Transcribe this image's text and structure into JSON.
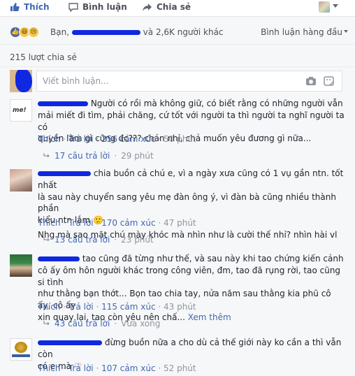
{
  "actions": {
    "like": "Thích",
    "comment": "Bình luận",
    "share": "Chia sẻ"
  },
  "reactions": {
    "icons": [
      "like-icon",
      "haha-icon",
      "sad-icon"
    ],
    "summary_prefix": "Bạn,",
    "summary_suffix": "và 2,6K người khác",
    "sort_label": "Bình luận hàng đầu"
  },
  "shares": "215 lượt chia sẻ",
  "composer": {
    "placeholder": "Viết bình luận..."
  },
  "comments": [
    {
      "text_lines": [
        "Người có rồi mà không giữ, có biết rằng có những người vẫn",
        "mải miết đi tìm, phải chăng, cứ tốt với người ta thì người ta nghĩ người ta có",
        "quyền làm gì cũng đc??? chán nhỉ, chả muốn yêu đương gì nữa..."
      ],
      "like": "Thích",
      "reply": "Trả lời",
      "reactions": "256 cảm xúc",
      "time": "50 phút",
      "replies": "17 câu trả lời",
      "replies_time": "29 phút"
    },
    {
      "text_lines": [
        "chia buồn cả chú e, vì a ngày xưa cũng có 1 vụ gần ntn. tốt nhất",
        "là sau này chuyển sang yêu mẹ đàn ông ý, vì đàn bà cũng nhiều thành phần",
        "kiểu ntn lắm"
      ],
      "extra_line": "Nhg mà sao mặt chú mày khóc mà nhìn như là cười thế nhỉ? nhìn hài vl",
      "like": "Thích",
      "reply": "Trả lời",
      "reactions": "170 cảm xúc",
      "time": "47 phút",
      "replies": "13 câu trả lời",
      "replies_time": "23 phút"
    },
    {
      "text_lines": [
        "tao cũng đã từng như thế, và sau này khi tao chứng kiến cảnh",
        "cô ấy ôm hôn người khác trong công viên, đm, tao đã rụng rời, tao cũng si tình",
        "như thằng bạn thớt... Bọn tao chia tay, nửa năm sau thằng kia phũ cô ấy, cô ấy",
        "xin quay lại, tao còn yêu nên chấ..."
      ],
      "see_more": "Xem thêm",
      "like": "Thích",
      "reply": "Trả lời",
      "reactions": "115 cảm xúc",
      "time": "43 phút",
      "replies": "43 câu trả lời",
      "replies_time": "Vừa xong"
    },
    {
      "text_lines": [
        "đừng buồn nữa a cho dù cả thế giới này ko cần a thì vẫn còn",
        "có e mà"
      ],
      "like": "Thích",
      "reply": "Trả lời",
      "reactions": "107 cảm xúc",
      "time": "52 phút"
    }
  ],
  "colors": {
    "link": "#4267b2",
    "redaction": "#1028e0",
    "background": "#f6f7f9"
  }
}
